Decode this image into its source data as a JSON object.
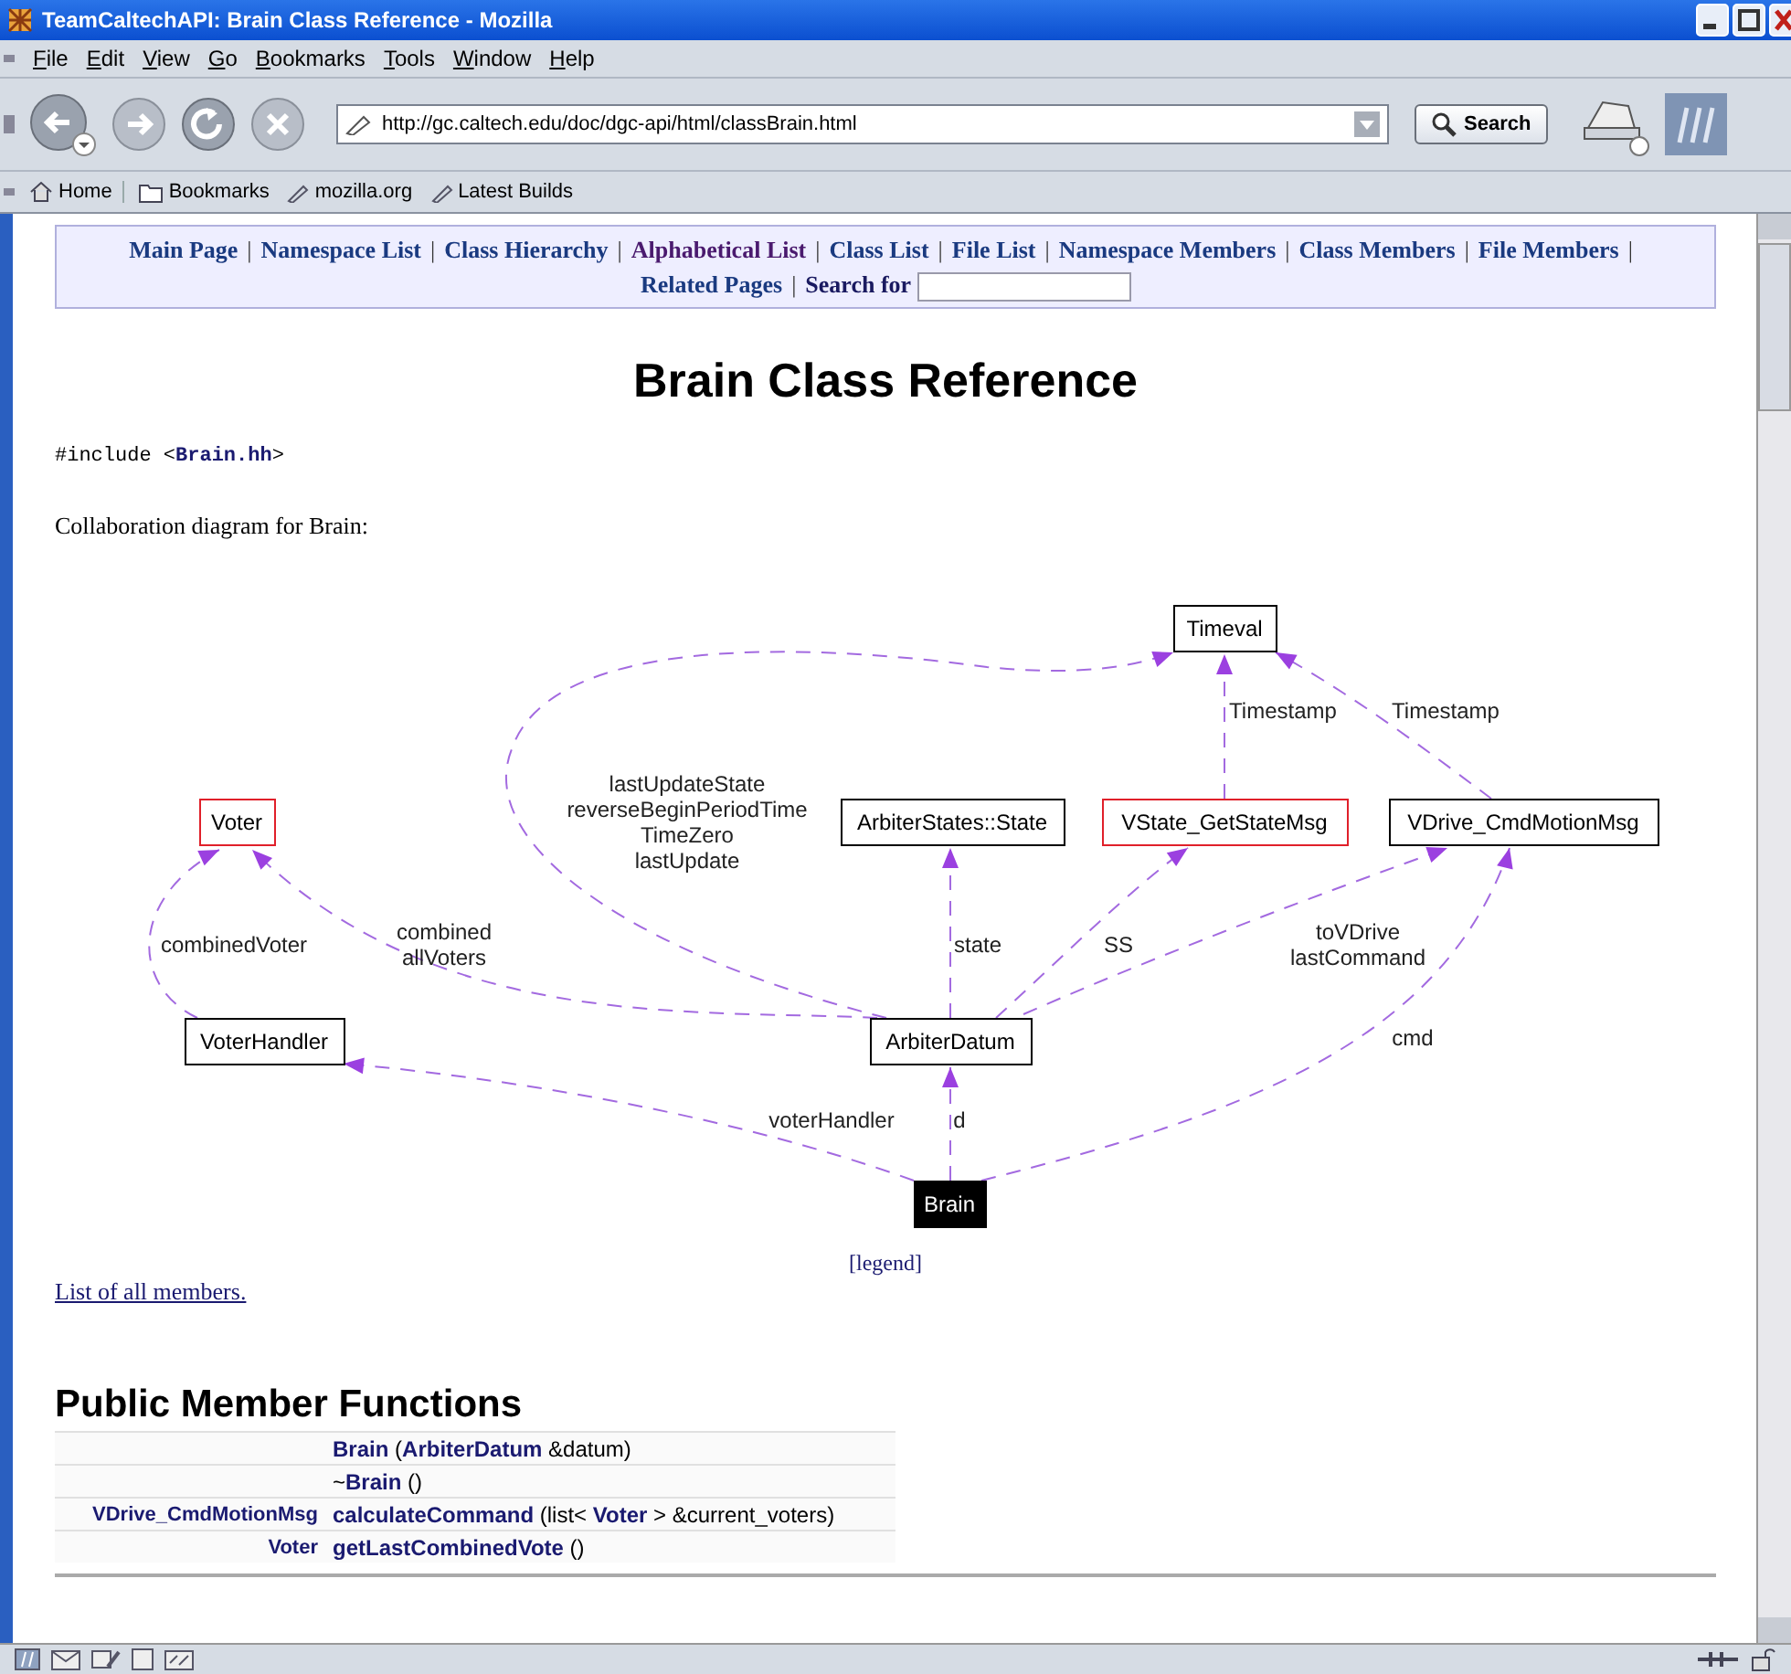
{
  "window": {
    "title": "TeamCaltechAPI: Brain Class Reference - Mozilla"
  },
  "menu": [
    "File",
    "Edit",
    "View",
    "Go",
    "Bookmarks",
    "Tools",
    "Window",
    "Help"
  ],
  "address": {
    "url": "http://gc.caltech.edu/doc/dgc-api/html/classBrain.html"
  },
  "search_button": "Search",
  "personal_toolbar": [
    {
      "label": "Home",
      "kind": "home"
    },
    {
      "label": "Bookmarks",
      "kind": "folder"
    },
    {
      "label": "mozilla.org",
      "kind": "link"
    },
    {
      "label": "Latest Builds",
      "kind": "link"
    }
  ],
  "nav": {
    "separator": "|",
    "links": [
      {
        "label": "Main Page",
        "visited": false
      },
      {
        "label": "Namespace List",
        "visited": false
      },
      {
        "label": "Class Hierarchy",
        "visited": false
      },
      {
        "label": "Alphabetical List",
        "visited": true
      },
      {
        "label": "Class List",
        "visited": false
      },
      {
        "label": "File List",
        "visited": false
      },
      {
        "label": "Namespace Members",
        "visited": false
      },
      {
        "label": "Class Members",
        "visited": false
      },
      {
        "label": "File Members",
        "visited": false
      },
      {
        "label": "Related Pages",
        "visited": false
      }
    ],
    "search_label": "Search for"
  },
  "heading": "Brain Class Reference",
  "include": {
    "directive": "#include",
    "open": "<",
    "file": "Brain.hh",
    "close": ">"
  },
  "diagram_caption": "Collaboration diagram for Brain:",
  "diagram": {
    "nodes": [
      {
        "label": "Timeval",
        "kind": "class"
      },
      {
        "label": "Voter",
        "kind": "incomplete"
      },
      {
        "label": "ArbiterStates::State",
        "kind": "class"
      },
      {
        "label": "VState_GetStateMsg",
        "kind": "incomplete"
      },
      {
        "label": "VDrive_CmdMotionMsg",
        "kind": "class"
      },
      {
        "label": "VoterHandler",
        "kind": "class"
      },
      {
        "label": "ArbiterDatum",
        "kind": "class"
      },
      {
        "label": "Brain",
        "kind": "self"
      }
    ],
    "edges": [
      {
        "lines": [
          "combinedVoter"
        ]
      },
      {
        "lines": [
          "combined",
          "allVoters"
        ]
      },
      {
        "lines": [
          "lastUpdateState",
          "reverseBeginPeriodTime",
          "TimeZero",
          "lastUpdate"
        ]
      },
      {
        "lines": [
          "Timestamp"
        ]
      },
      {
        "lines": [
          "Timestamp"
        ]
      },
      {
        "lines": [
          "state"
        ]
      },
      {
        "lines": [
          "SS"
        ]
      },
      {
        "lines": [
          "toVDrive",
          "lastCommand"
        ]
      },
      {
        "lines": [
          "cmd"
        ]
      },
      {
        "lines": [
          "voterHandler"
        ]
      },
      {
        "lines": [
          "d"
        ]
      }
    ]
  },
  "legend_link": "[legend]",
  "members_link": "List of all members.",
  "section_heading": "Public Member Functions",
  "members": [
    {
      "signature": "**Brain** (**ArbiterDatum** &datum)"
    },
    {
      "signature": "~**Brain** ()"
    },
    {
      "type": "VDrive_CmdMotionMsg",
      "signature": "**calculateCommand** (list< **Voter** > &current_voters)"
    },
    {
      "type": "Voter",
      "signature": "**getLastCombinedVote** ()"
    }
  ]
}
